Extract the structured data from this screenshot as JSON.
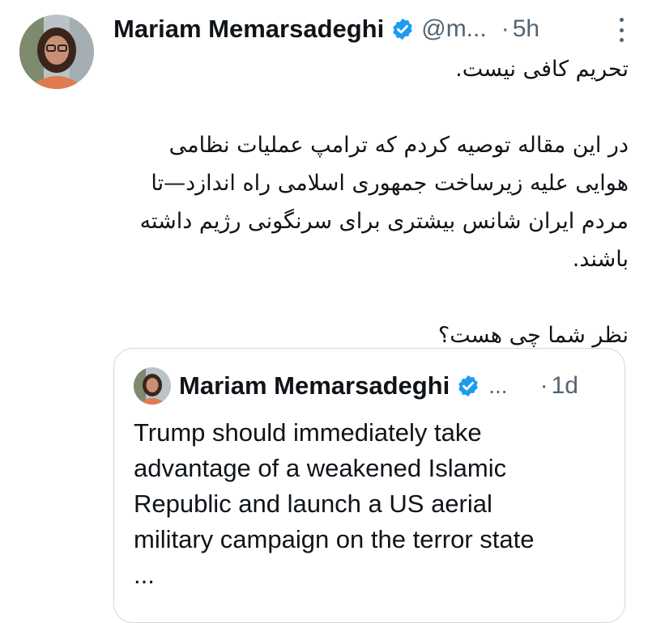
{
  "colors": {
    "text_primary": "#0f1419",
    "text_secondary": "#536471",
    "verified_badge": "#1d9bf0",
    "card_border": "#cfd9de"
  },
  "tweet": {
    "author_name": "Mariam Memarsadeghi",
    "handle": "@m...",
    "separator": "·",
    "time": "5h",
    "verified_icon": "verified-badge-icon",
    "more_icon": "vertical-ellipsis-icon",
    "paragraphs": [
      "تحریم کافی نیست.",
      "در این مقاله توصیه کردم که ترامپ عملیات نظامی\nهوایی علیه زیرساخت جمهوری اسلامی راه اندازد—تا\nمردم ایران شانس بیشتری برای سرنگونی رژیم داشته\nباشند.",
      "نظر شما چی هست؟"
    ]
  },
  "quoted_tweet": {
    "author_name": "Mariam Memarsadeghi",
    "name_ellipsis": "...",
    "separator": "·",
    "time": "1d",
    "text": "Trump should immediately take\nadvantage of a weakened Islamic\nRepublic and launch a US aerial\nmilitary campaign on the terror state\n..."
  }
}
